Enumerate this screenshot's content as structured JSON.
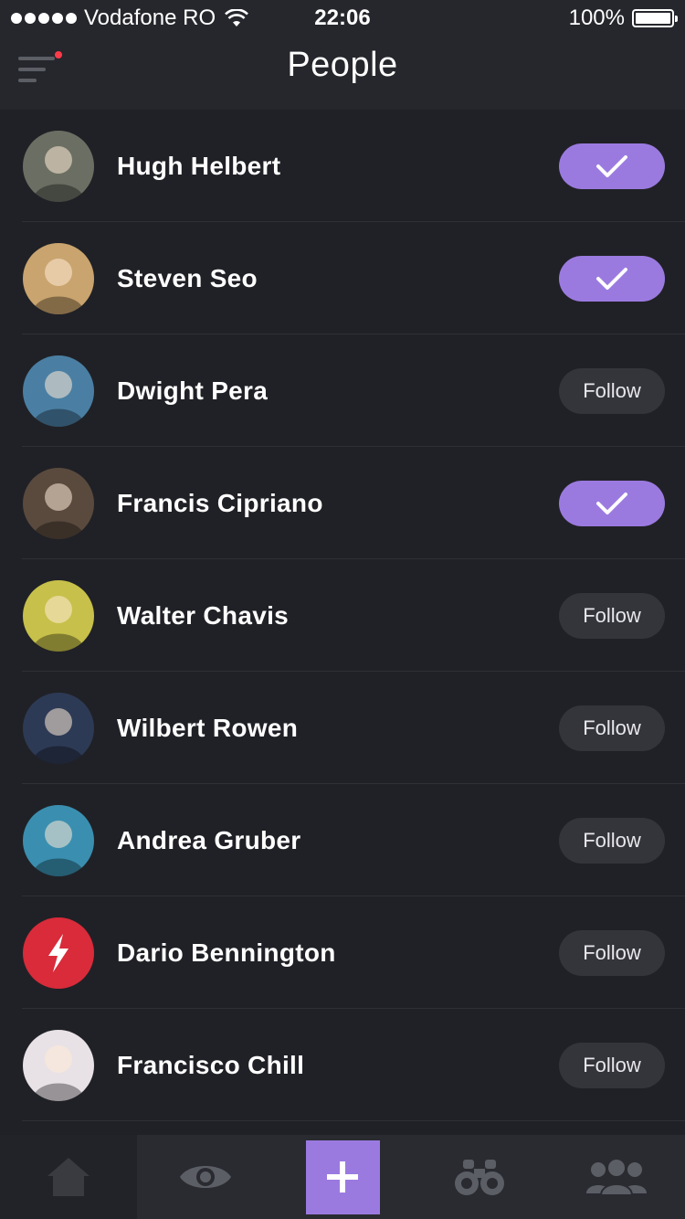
{
  "status_bar": {
    "carrier": "Vodafone RO",
    "time": "22:06",
    "battery": "100%"
  },
  "header": {
    "title": "People",
    "menu_has_notification": true
  },
  "people": [
    {
      "name": "Hugh Helbert",
      "following": true,
      "button_label": "",
      "avatar_color": "#6b6f63"
    },
    {
      "name": "Steven Seo",
      "following": true,
      "button_label": "",
      "avatar_color": "#c9a46e"
    },
    {
      "name": "Dwight Pera",
      "following": false,
      "button_label": "Follow",
      "avatar_color": "#4a7fa3"
    },
    {
      "name": "Francis Cipriano",
      "following": true,
      "button_label": "",
      "avatar_color": "#5a4a3e"
    },
    {
      "name": "Walter Chavis",
      "following": false,
      "button_label": "Follow",
      "avatar_color": "#c7c04a"
    },
    {
      "name": "Wilbert Rowen",
      "following": false,
      "button_label": "Follow",
      "avatar_color": "#2d3a55"
    },
    {
      "name": "Andrea Gruber",
      "following": false,
      "button_label": "Follow",
      "avatar_color": "#3a8fb0"
    },
    {
      "name": "Dario Bennington",
      "following": false,
      "button_label": "Follow",
      "avatar_color": "#d92b3a"
    },
    {
      "name": "Francisco Chill",
      "following": false,
      "button_label": "Follow",
      "avatar_color": "#e8e2e6"
    }
  ],
  "tabbar": {
    "tabs": [
      "home-icon",
      "eye-icon",
      "plus-icon",
      "binoculars-icon",
      "people-icon"
    ],
    "accent": "#9b7ae0"
  },
  "colors": {
    "background": "#202126",
    "header": "#26272c",
    "accent": "#9b7ae0",
    "follow_button": "#34353b",
    "icon_gray": "#5c5e66"
  }
}
